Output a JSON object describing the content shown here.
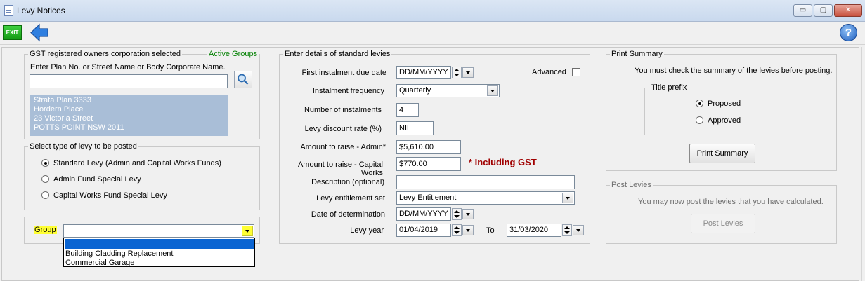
{
  "window": {
    "title": "Levy Notices",
    "minimize": "▭",
    "maximize": "▢",
    "close": "✕"
  },
  "toolbar": {
    "exit_label": "EXIT",
    "help_label": "?"
  },
  "gst_group": {
    "legend": "GST registered owners corporation selected",
    "active_groups": "Active Groups",
    "search_label": "Enter Plan No. or Street Name or Body Corporate Name.",
    "search_value": "",
    "address_lines": [
      "Strata Plan 3333",
      "Hordern Place",
      "23 Victoria Street",
      "POTTS POINT  NSW  2011"
    ]
  },
  "levy_type": {
    "legend": "Select type of levy to be posted",
    "options": [
      {
        "label": "Standard Levy (Admin and Capital Works Funds)",
        "checked": true
      },
      {
        "label": "Admin Fund Special Levy",
        "checked": false
      },
      {
        "label": "Capital Works Fund Special Levy",
        "checked": false
      }
    ]
  },
  "group": {
    "label": "Group",
    "value": "",
    "dropdown_options": [
      "",
      "Building Cladding Replacement",
      "Commercial Garage"
    ]
  },
  "standard_levies": {
    "legend": "Enter details of standard levies",
    "first_instalment_label": "First instalment due date",
    "first_instalment_value": "DD/MM/YYYY",
    "advanced_label": "Advanced",
    "frequency_label": "Instalment frequency",
    "frequency_value": "Quarterly",
    "num_instalments_label": "Number of instalments",
    "num_instalments_value": "4",
    "discount_label": "Levy discount rate (%)",
    "discount_value": "NIL",
    "admin_label": "Amount to raise - Admin*",
    "admin_value": "$5,610.00",
    "capital_label_1": "Amount to raise - Capital",
    "capital_label_2": "Works",
    "capital_value": "$770.00",
    "gst_note": "* Including GST",
    "description_label": "Description (optional)",
    "description_value": "",
    "entitlement_label": "Levy entitlement set",
    "entitlement_value": "Levy Entitlement",
    "determination_label": "Date of determination",
    "determination_value": "DD/MM/YYYY",
    "levy_year_label": "Levy year",
    "levy_year_from": "01/04/2019",
    "to_label": "To",
    "levy_year_to": "31/03/2020"
  },
  "print_summary": {
    "legend": "Print Summary",
    "instruction": "You must check the summary of the levies before posting.",
    "title_prefix_legend": "Title prefix",
    "options": [
      {
        "label": "Proposed",
        "checked": true
      },
      {
        "label": "Approved",
        "checked": false
      }
    ],
    "button_label": "Print Summary"
  },
  "post_levies": {
    "legend": "Post Levies",
    "instruction": "You may now post the levies that you have calculated.",
    "button_label": "Post Levies"
  },
  "colors": {
    "address_bg": "#a9bed7",
    "gst_note": "#a00000",
    "active_groups": "#008000",
    "highlight": "#ffff33",
    "selection": "#0a64d2"
  }
}
